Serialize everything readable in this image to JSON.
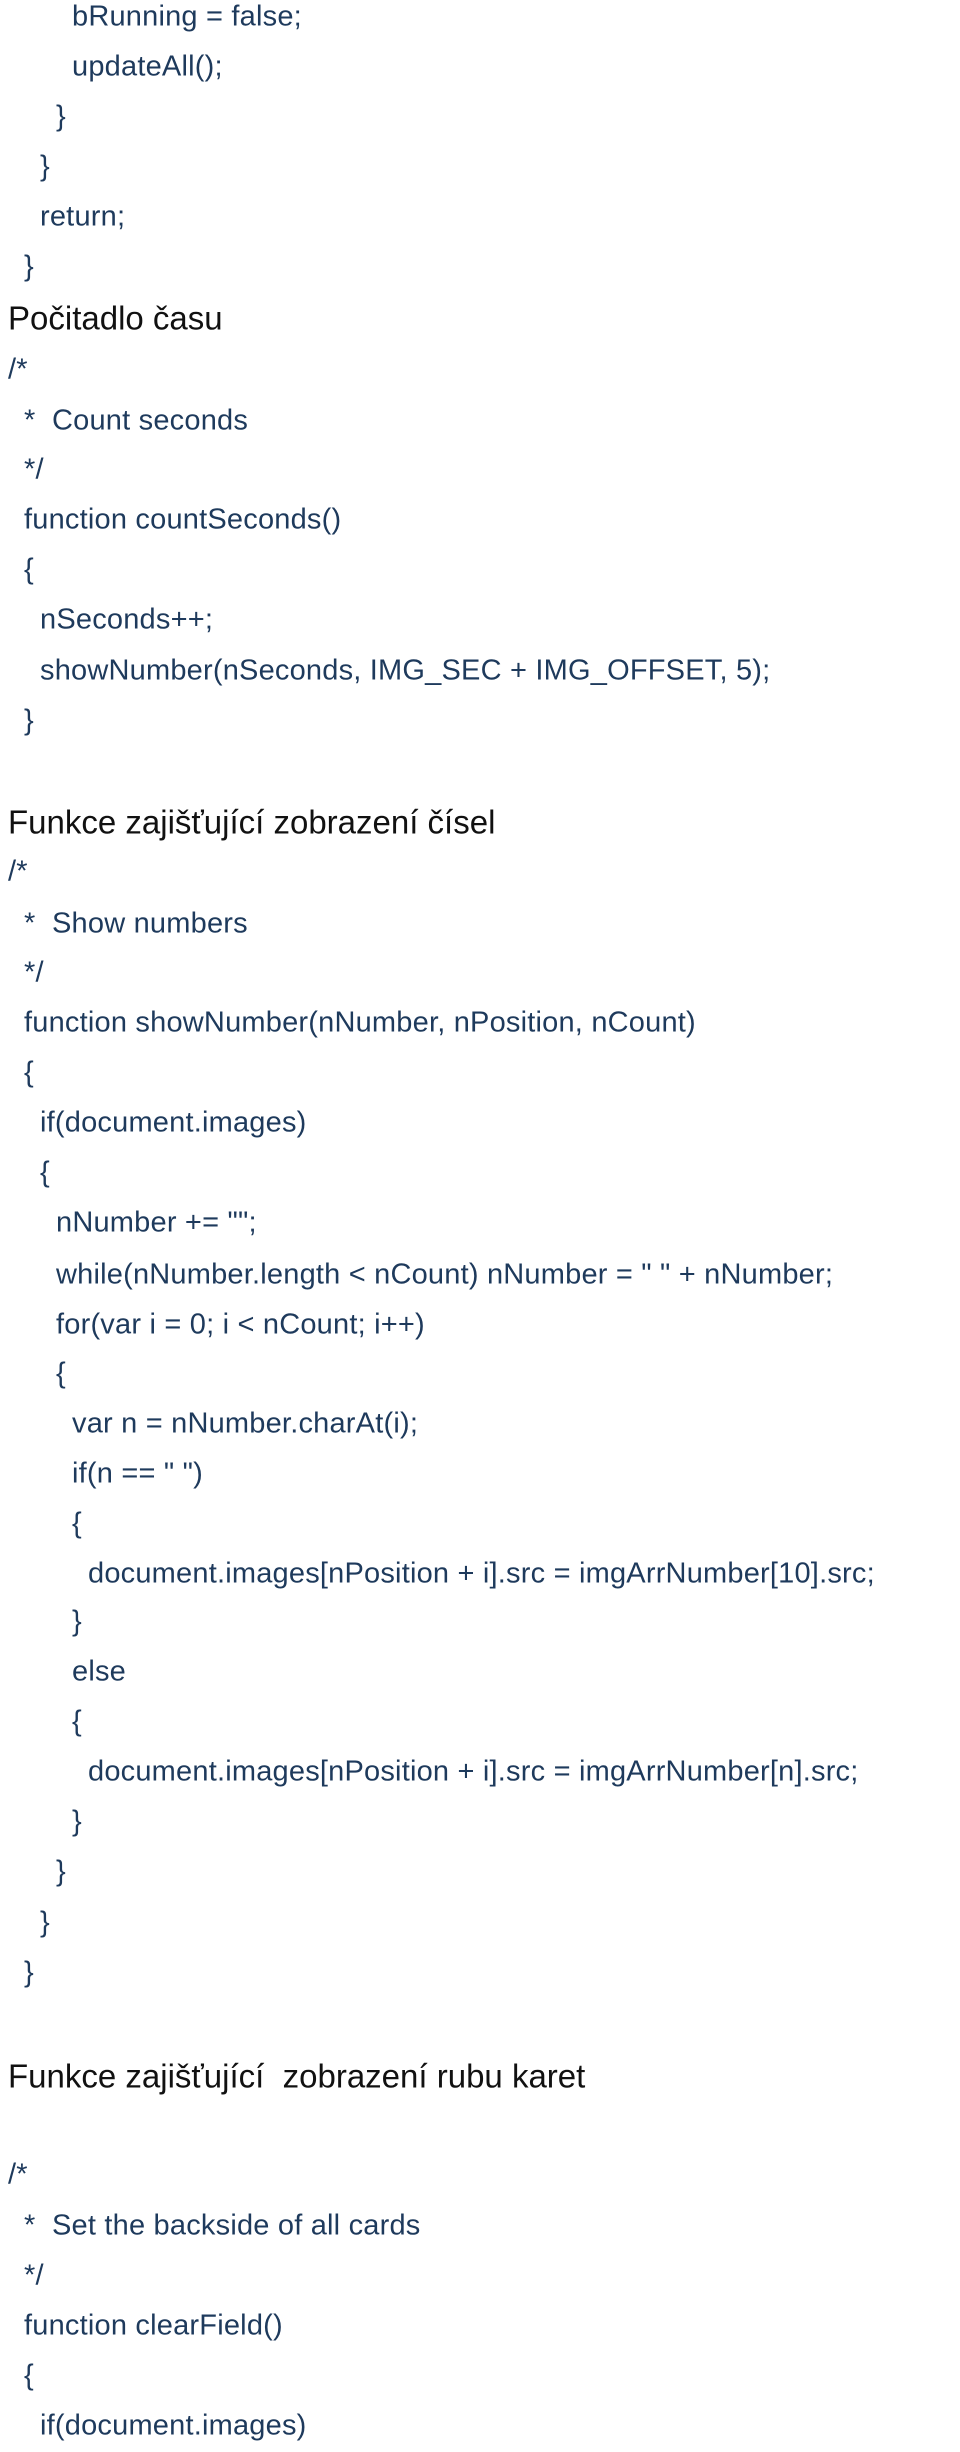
{
  "colors": {
    "code_text": "#1e3a5c",
    "heading_text": "#111111",
    "background": "#ffffff"
  },
  "lines": [
    {
      "kind": "code",
      "indent": 4,
      "text": "bRunning = false;"
    },
    {
      "kind": "code",
      "indent": 4,
      "text": "updateAll();"
    },
    {
      "kind": "code",
      "indent": 3,
      "text": "}"
    },
    {
      "kind": "code",
      "indent": 2,
      "text": "}"
    },
    {
      "kind": "code",
      "indent": 2,
      "text": "return;"
    },
    {
      "kind": "code",
      "indent": 1,
      "text": "}"
    },
    {
      "kind": "heading",
      "indent": 0,
      "text": "Počitadlo času"
    },
    {
      "kind": "code",
      "indent": 0,
      "text": "/*"
    },
    {
      "kind": "code",
      "indent": 1,
      "text": "*  Count seconds"
    },
    {
      "kind": "code",
      "indent": 1,
      "text": "*/"
    },
    {
      "kind": "code",
      "indent": 1,
      "text": "function countSeconds()"
    },
    {
      "kind": "code",
      "indent": 1,
      "text": "{"
    },
    {
      "kind": "code",
      "indent": 2,
      "text": "nSeconds++;"
    },
    {
      "kind": "code",
      "indent": 2,
      "text": "showNumber(nSeconds, IMG_SEC + IMG_OFFSET, 5);"
    },
    {
      "kind": "code",
      "indent": 1,
      "text": "}"
    },
    {
      "kind": "heading",
      "indent": 0,
      "text": "Funkce zajišťující zobrazení čísel"
    },
    {
      "kind": "code",
      "indent": 0,
      "text": "/*"
    },
    {
      "kind": "code",
      "indent": 1,
      "text": "*  Show numbers"
    },
    {
      "kind": "code",
      "indent": 1,
      "text": "*/"
    },
    {
      "kind": "code",
      "indent": 1,
      "text": "function showNumber(nNumber, nPosition, nCount)"
    },
    {
      "kind": "code",
      "indent": 1,
      "text": "{"
    },
    {
      "kind": "code",
      "indent": 2,
      "text": "if(document.images)"
    },
    {
      "kind": "code",
      "indent": 2,
      "text": "{"
    },
    {
      "kind": "code",
      "indent": 3,
      "text": "nNumber += \"\";"
    },
    {
      "kind": "code",
      "indent": 3,
      "text": "while(nNumber.length < nCount) nNumber = \" \" + nNumber;"
    },
    {
      "kind": "code",
      "indent": 3,
      "text": "for(var i = 0; i < nCount; i++)"
    },
    {
      "kind": "code",
      "indent": 3,
      "text": "{"
    },
    {
      "kind": "code",
      "indent": 4,
      "text": "var n = nNumber.charAt(i);"
    },
    {
      "kind": "code",
      "indent": 4,
      "text": "if(n == \" \")"
    },
    {
      "kind": "code",
      "indent": 4,
      "text": "{"
    },
    {
      "kind": "code",
      "indent": 5,
      "text": "document.images[nPosition + i].src = imgArrNumber[10].src;"
    },
    {
      "kind": "code",
      "indent": 4,
      "text": "}"
    },
    {
      "kind": "code",
      "indent": 4,
      "text": "else"
    },
    {
      "kind": "code",
      "indent": 4,
      "text": "{"
    },
    {
      "kind": "code",
      "indent": 5,
      "text": "document.images[nPosition + i].src = imgArrNumber[n].src;"
    },
    {
      "kind": "code",
      "indent": 4,
      "text": "}"
    },
    {
      "kind": "code",
      "indent": 3,
      "text": "}"
    },
    {
      "kind": "code",
      "indent": 2,
      "text": "}"
    },
    {
      "kind": "code",
      "indent": 1,
      "text": "}"
    },
    {
      "kind": "heading",
      "indent": 0,
      "text": "Funkce zajišťující  zobrazení rubu karet"
    },
    {
      "kind": "code",
      "indent": 0,
      "text": "/*"
    },
    {
      "kind": "code",
      "indent": 1,
      "text": "*  Set the backside of all cards"
    },
    {
      "kind": "code",
      "indent": 1,
      "text": "*/"
    },
    {
      "kind": "code",
      "indent": 1,
      "text": "function clearField()"
    },
    {
      "kind": "code",
      "indent": 1,
      "text": "{"
    },
    {
      "kind": "code",
      "indent": 2,
      "text": "if(document.images)"
    }
  ]
}
